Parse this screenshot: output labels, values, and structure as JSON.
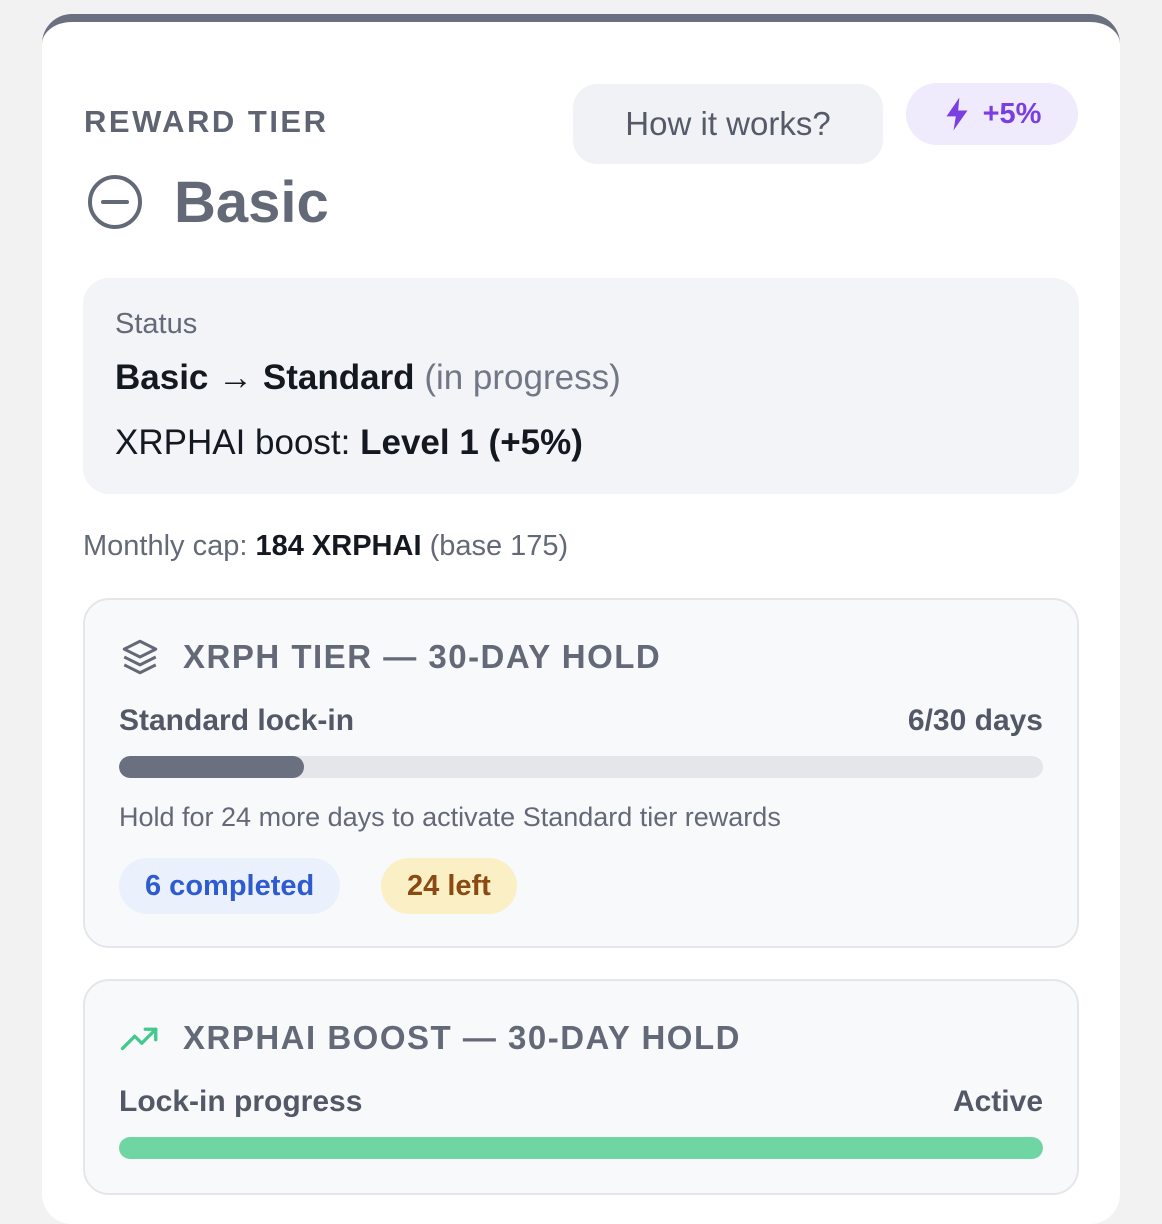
{
  "header": {
    "eyebrow": "REWARD TIER",
    "how_it_works_label": "How it works?",
    "boost_badge": "+5%",
    "tier_name": "Basic"
  },
  "status": {
    "label": "Status",
    "from_tier": "Basic",
    "arrow": "→",
    "to_tier": "Standard",
    "progress_note": "(in progress)",
    "boost_label": "XRPHAI boost:",
    "boost_value": "Level 1 (+5%)"
  },
  "monthly_cap": {
    "label": "Monthly cap:",
    "value": "184 XRPHAI",
    "base": "(base 175)"
  },
  "xrph_tier": {
    "title": "XRPH TIER — 30-DAY HOLD",
    "progress_label": "Standard lock-in",
    "progress_value": "6/30 days",
    "progress_fraction": 0.2,
    "hint": "Hold for 24 more days to activate Standard tier rewards",
    "completed_chip": "6 completed",
    "left_chip": "24 left"
  },
  "xrphai_boost": {
    "title": "XRPHAI BOOST — 30-DAY HOLD",
    "progress_label": "Lock-in progress",
    "progress_value": "Active",
    "progress_fraction": 1.0
  },
  "icons": {
    "boost": "lightning-bolt-icon",
    "tier": "minus-circle-icon",
    "xrph": "layers-stack-icon",
    "xrphai": "trending-up-icon"
  },
  "colors": {
    "header_bar": "#6b7080",
    "boost_accent": "#7a3fe0",
    "tier_progress": "#6b7080",
    "boost_progress": "#6fd6a3",
    "trend_icon": "#43c98b"
  }
}
